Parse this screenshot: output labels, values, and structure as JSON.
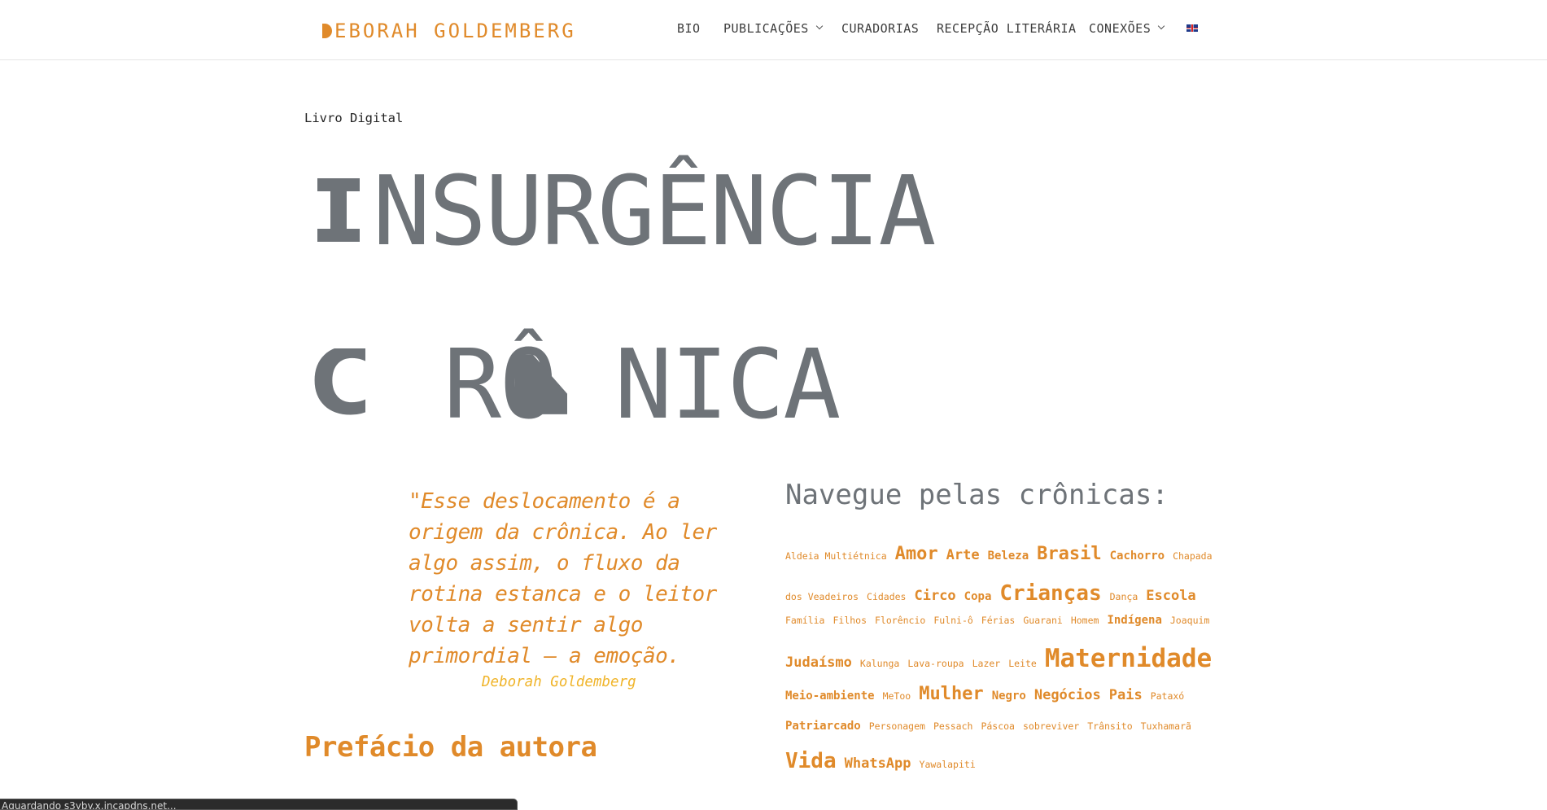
{
  "header": {
    "logo_first_letter": "D",
    "logo_text": "EBORAH GOLDEMBERG",
    "nav": [
      {
        "label": "BIO",
        "has_dropdown": false
      },
      {
        "label": "PUBLICAÇÕES",
        "has_dropdown": true
      },
      {
        "label": "CURADORIAS",
        "has_dropdown": false
      },
      {
        "label": "RECEPÇÃO LITERÁRIA",
        "has_dropdown": false
      },
      {
        "label": "CONEXÕES",
        "has_dropdown": true
      }
    ],
    "language_flag": "uk-flag-icon"
  },
  "hero": {
    "kicker": "Livro Digital",
    "line1_rest": "NSURGÊNCIA",
    "line2_part1": "RÔ",
    "line2_part2": "NICA"
  },
  "quote": {
    "text": "\"Esse deslocamento é a origem da crônica. Ao ler algo assim, o fluxo da rotina estanca e o leitor volta a sentir algo primordial – a emoção.",
    "author": "Deborah Goldemberg"
  },
  "preface": {
    "title": "Prefácio da autora"
  },
  "tags": {
    "title": "Navegue pelas crônicas:",
    "rows": [
      [
        [
          "Aldeia Multiétnica",
          1
        ],
        [
          "Amor",
          4
        ],
        [
          "Arte",
          3
        ],
        [
          "Beleza",
          2
        ],
        [
          "Brasil",
          4
        ],
        [
          "Cachorro",
          2
        ],
        [
          "Chapada",
          1
        ]
      ],
      [
        [
          "dos Veadeiros",
          1
        ],
        [
          "Cidades",
          1
        ],
        [
          "Circo",
          3
        ],
        [
          "Copa",
          2
        ],
        [
          "Crianças",
          5
        ],
        [
          "Dança",
          1
        ],
        [
          "Escola",
          3
        ]
      ],
      [
        [
          "Família",
          1
        ],
        [
          "Filhos",
          1
        ],
        [
          "Florêncio",
          1
        ],
        [
          "Fulni-ô",
          1
        ],
        [
          "Férias",
          1
        ],
        [
          "Guarani",
          1
        ],
        [
          "Homem",
          1
        ],
        [
          "Indígena",
          2
        ],
        [
          "Joaquim",
          1
        ]
      ],
      [
        [
          "Judaísmo",
          3
        ],
        [
          "Kalunga",
          1
        ],
        [
          "Lava-roupa",
          1
        ],
        [
          "Lazer",
          1
        ],
        [
          "Leite",
          1
        ],
        [
          "Maternidade",
          6
        ]
      ],
      [
        [
          "Meio-ambiente",
          2
        ],
        [
          "MeToo",
          1
        ],
        [
          "Mulher",
          4
        ],
        [
          "Negro",
          2
        ],
        [
          "Negócios",
          3
        ],
        [
          "Pais",
          3
        ],
        [
          "Pataxó",
          1
        ]
      ],
      [
        [
          "Patriarcado",
          2
        ],
        [
          "Personagem",
          1
        ],
        [
          "Pessach",
          1
        ],
        [
          "Páscoa",
          1
        ],
        [
          "sobreviver",
          1
        ],
        [
          "Trânsito",
          1
        ],
        [
          "Tuxhamarã",
          1
        ]
      ],
      [
        [
          "Vida",
          5
        ],
        [
          "WhatsApp",
          3
        ],
        [
          "Yawalapiti",
          1
        ]
      ]
    ]
  },
  "status_bar": {
    "text": "Aguardando s3yby.x.incapdns.net..."
  },
  "colors": {
    "accent": "#e08a2a",
    "hero_gray": "#6e7378",
    "author_yellow": "#f0b429"
  }
}
